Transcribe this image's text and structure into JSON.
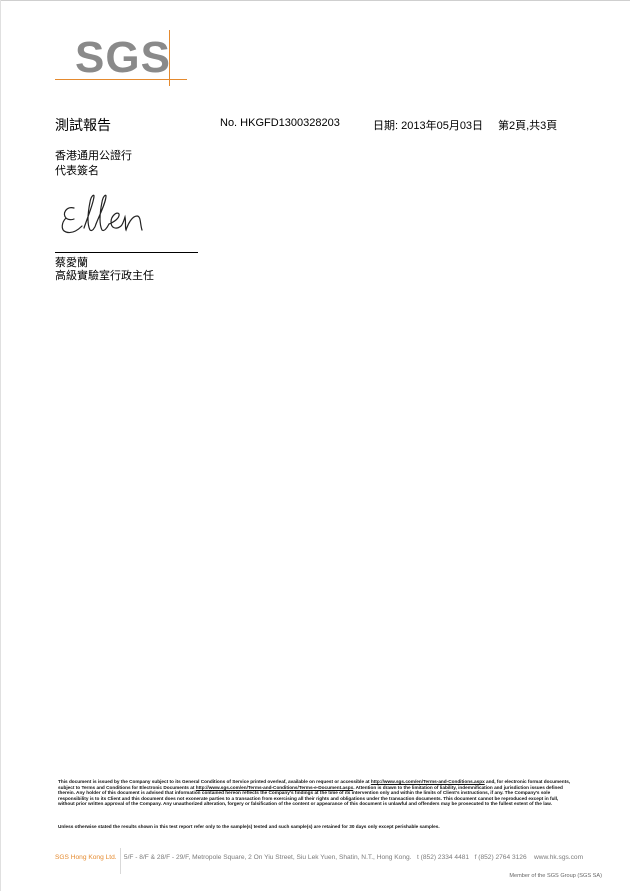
{
  "logo": {
    "text": "SGS"
  },
  "header": {
    "title": "測試報告",
    "report_no": "No. HKGFD1300328203",
    "date": "日期: 2013年05月03日",
    "page": "第2頁,共3頁"
  },
  "signatory": {
    "company": "香港通用公證行",
    "role": "代表簽名",
    "signature_text": "Ellen",
    "name": "蔡愛蘭",
    "title": "高級實驗室行政主任"
  },
  "disclaimer": {
    "part1": "This document is issued by the Company subject to its General Conditions of Service printed overleaf, available on request or accessible at ",
    "link1": "http://www.sgs.com/en/Terms-and-Conditions.aspx",
    "part2": " and, for electronic format documents, subject to Terms and Conditions for Electronic Documents at ",
    "link2": "http://www.sgs.com/en/Terms-and-Conditions/Terms-e-Document.aspx",
    "part3": ". Attention is drawn to the limitation of liability, indemnification and jurisdiction issues defined therein. Any holder of this document is advised that information contained hereon reflects the Company's findings at the time of its intervention only and within the limits of Client's instructions, if any. The Company's sole responsibility is to its Client and this document does not exonerate parties to a transaction from exercising all their rights and obligations under the transaction documents. This document cannot be reproduced except in full, without prior written approval of the Company. Any unauthorized alteration, forgery or falsification of the content or appearance of this document is unlawful and offenders may be prosecuted to the fullest extent of the law.",
    "retention": "Unless otherwise stated the results shown in this test report refer only to the sample(s) tested and such sample(s) are retained for 30 days only except perishable samples."
  },
  "footer": {
    "company": "SGS Hong Kong Ltd.",
    "address": "5/F - 8/F & 28/F - 29/F, Metropole Square, 2 On Yiu Street, Siu Lek Yuen, Shatin, N.T., Hong Kong.",
    "tel": "t  (852) 2334 4481",
    "fax": "f  (852) 2764 3126",
    "web": "www.hk.sgs.com",
    "member": "Member of the SGS Group (SGS SA)"
  },
  "colors": {
    "accent": "#e58a2e",
    "logo_gray": "#8a8a8a"
  }
}
